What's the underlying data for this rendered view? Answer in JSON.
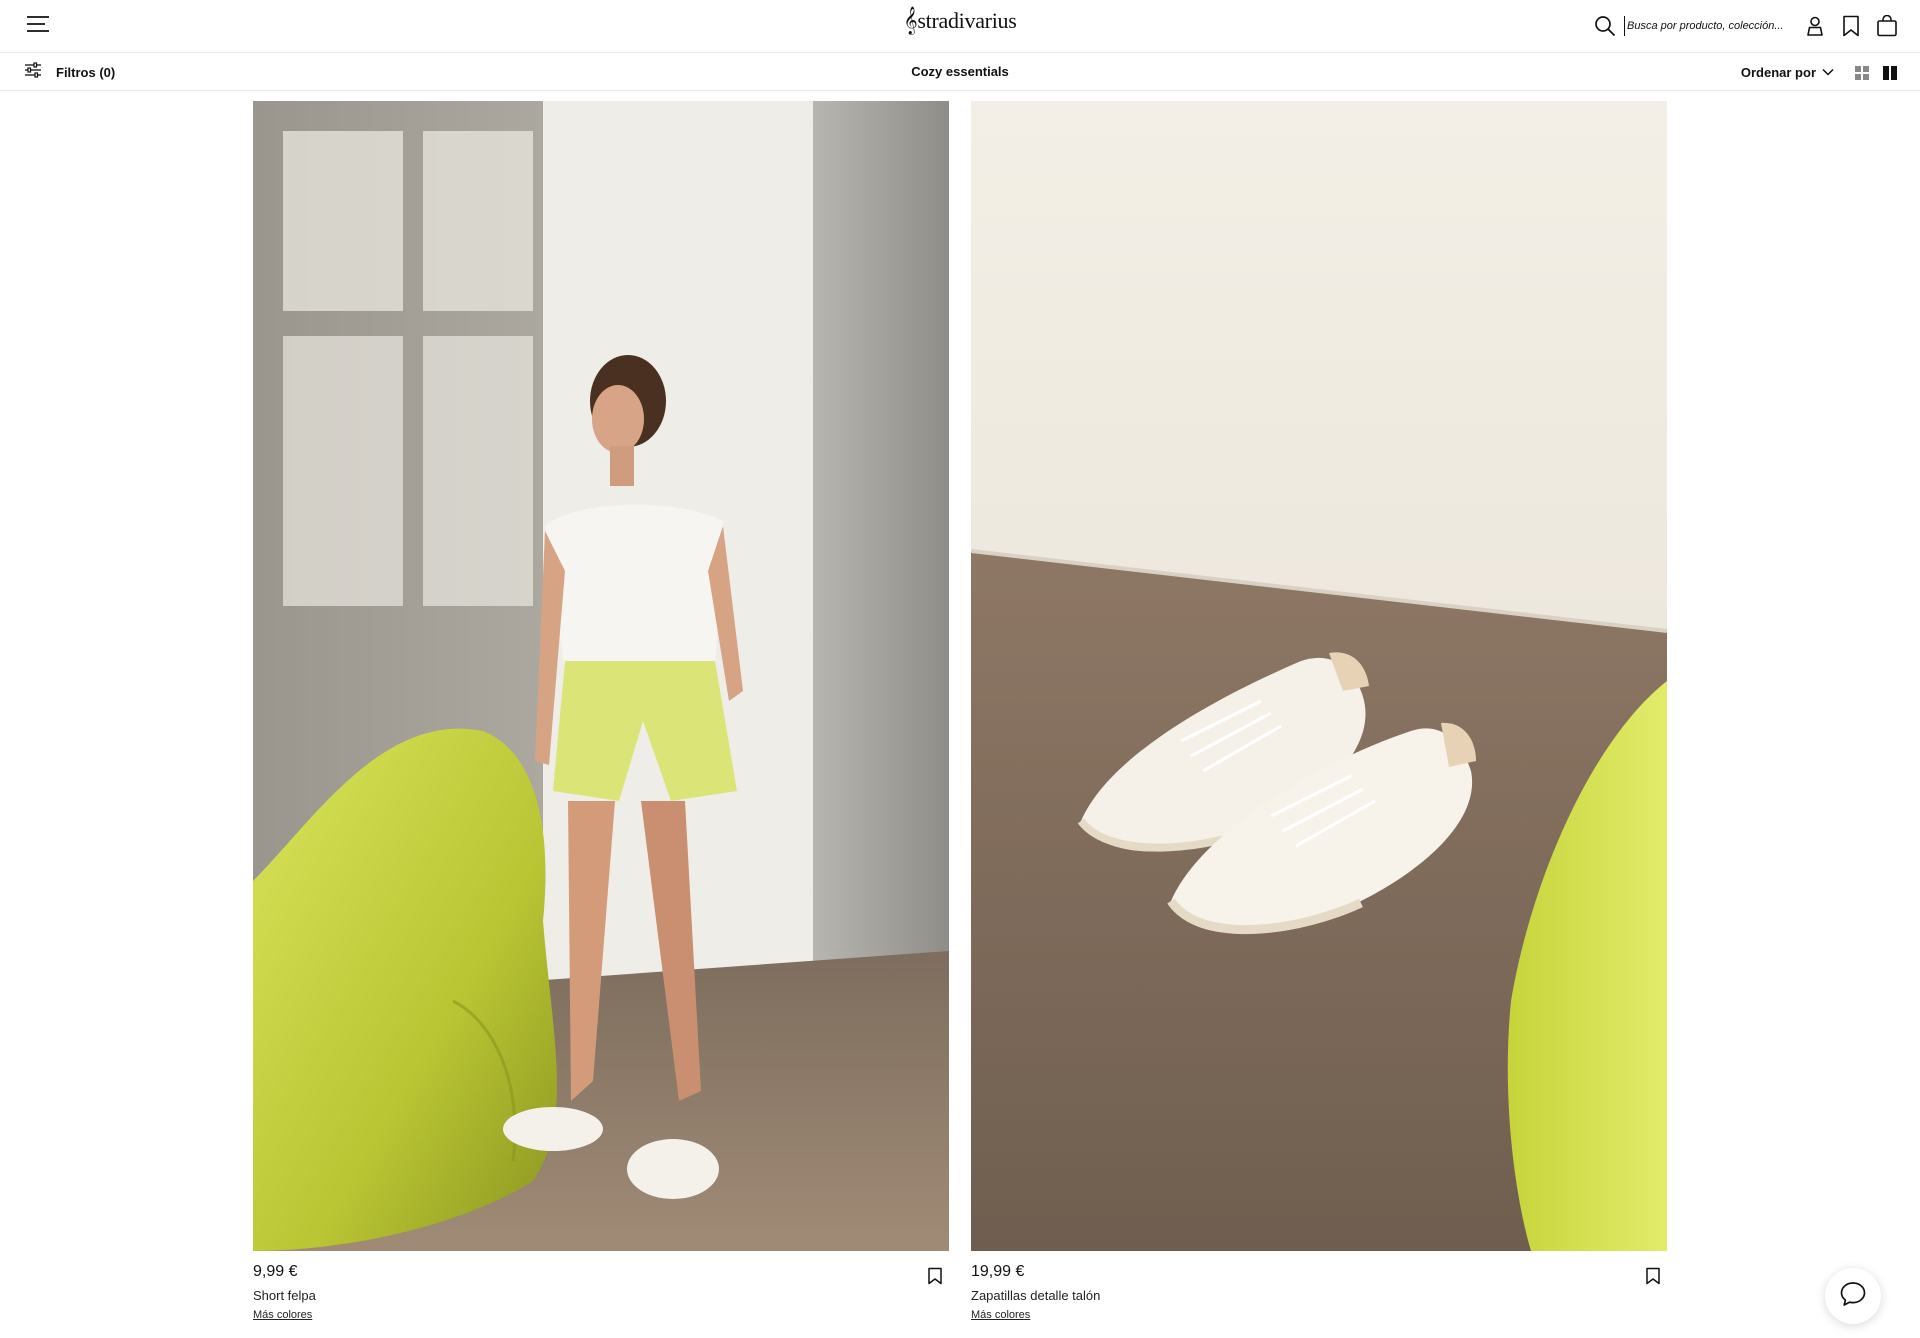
{
  "header": {
    "brand": "stradivarius",
    "brand_mark": "𝄞",
    "search_placeholder": "Busca por producto, colección...",
    "icons": [
      "menu-icon",
      "search-icon",
      "user-icon",
      "bookmark-icon",
      "bag-icon"
    ]
  },
  "toolbar": {
    "filters_label": "Filtros (0)",
    "collection_title": "Cozy essentials",
    "sort_label": "Ordenar por",
    "icons": [
      "filter-sliders-icon",
      "chevron-down-icon",
      "grid-view-icon",
      "double-view-icon"
    ]
  },
  "products": [
    {
      "price": "9,99 €",
      "name": "Short felpa",
      "more_colors": "Más colores",
      "image": "model in white sleeveless top and lime shorts leaning on wall beside lime bean bag"
    },
    {
      "price": "19,99 €",
      "name": "Zapatillas detalle talón",
      "more_colors": "Más colores",
      "image": "pair of white sneakers with beige heel on concrete floor beside lime bean bag"
    }
  ],
  "colors": {
    "lime": "#c9d84a",
    "wall": "#f2f0ea",
    "floor": "#8a7562",
    "text": "#111111"
  },
  "chat": {
    "icon": "chat-bubble-icon"
  }
}
